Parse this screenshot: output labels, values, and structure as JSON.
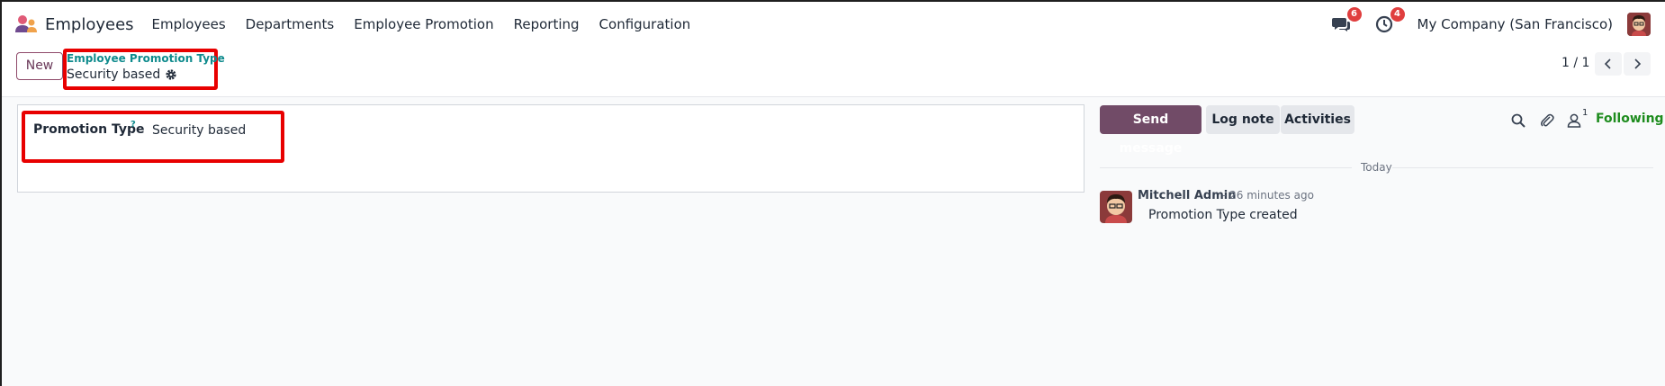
{
  "app": {
    "name": "Employees"
  },
  "menu": [
    "Employees",
    "Departments",
    "Employee Promotion",
    "Reporting",
    "Configuration"
  ],
  "systray": {
    "messages_badge": "6",
    "activities_badge": "4",
    "company": "My Company (San Francisco)"
  },
  "control": {
    "new_label": "New",
    "breadcrumb_parent": "Employee Promotion Type",
    "breadcrumb_current": "Security based",
    "pager": "1 / 1"
  },
  "form": {
    "field_label": "Promotion Type",
    "help_mark": "?",
    "field_value": "Security based"
  },
  "chatter": {
    "send_message": "Send message",
    "log_note": "Log note",
    "activities": "Activities",
    "follower_count": "1",
    "following": "Following",
    "date_separator": "Today",
    "message": {
      "author": "Mitchell Admin",
      "time": "- 26 minutes ago",
      "body": "Promotion Type created"
    }
  },
  "colors": {
    "primary": "#714b67",
    "link": "#0f8b8d",
    "highlight_box": "#e80000",
    "following": "#1e8c1e",
    "badge": "#e03e3e"
  }
}
